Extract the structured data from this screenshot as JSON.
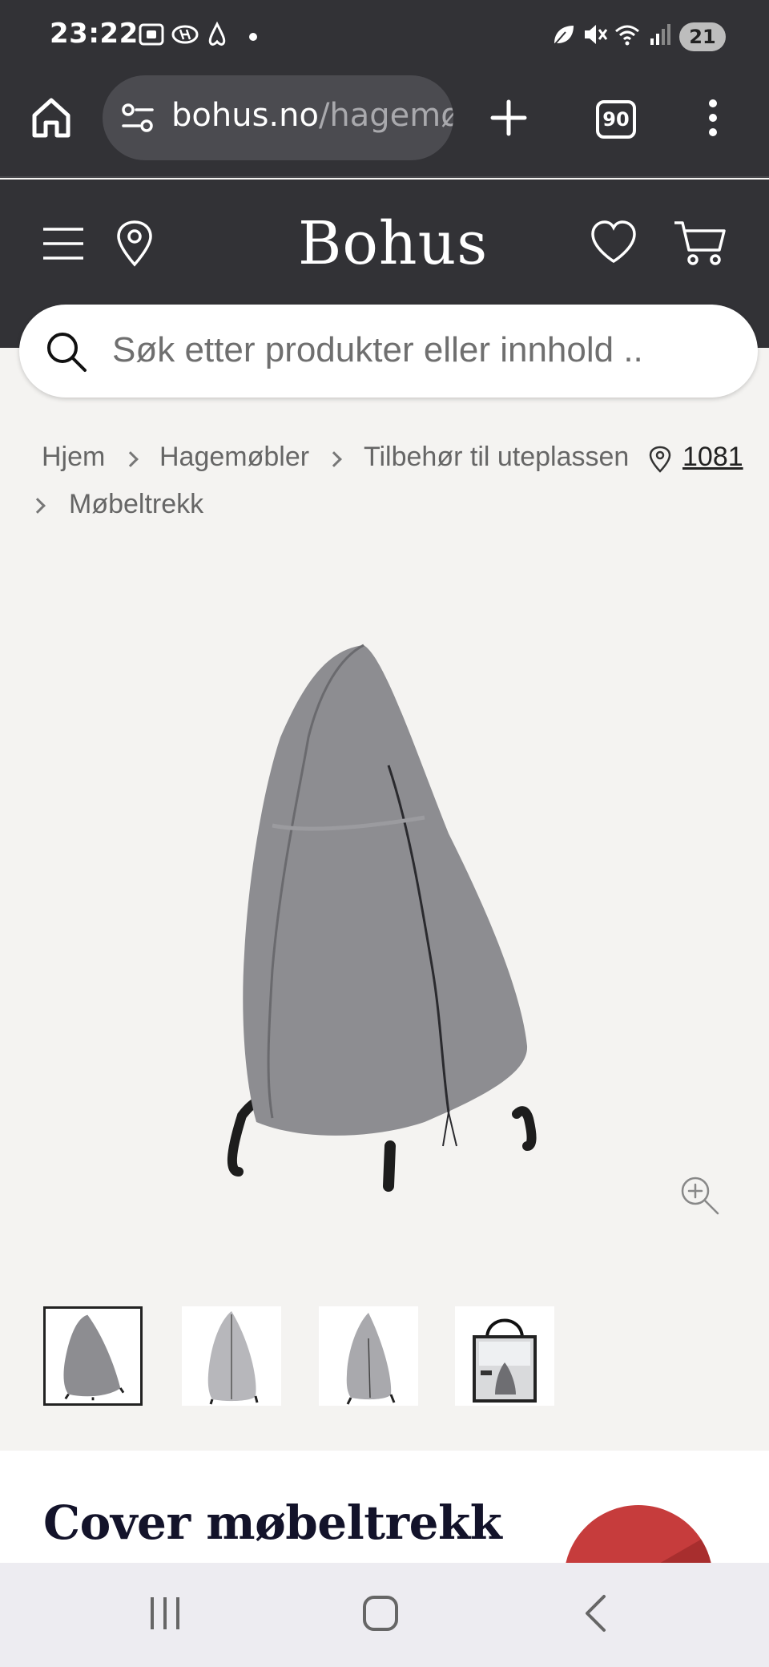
{
  "status_bar": {
    "time": "23:22",
    "battery": "21"
  },
  "browser": {
    "url_host": "bohus.no",
    "url_path": "/hagemø",
    "tab_count": "90"
  },
  "site": {
    "logo": "Bohus",
    "search_placeholder": "Søk etter produkter eller innhold .."
  },
  "breadcrumb": {
    "items": [
      "Hjem",
      "Hagemøbler",
      "Tilbehør til uteplassen",
      "Møbeltrekk"
    ],
    "store_code": "1081"
  },
  "product": {
    "title": "Cover møbeltrekk",
    "thumbnails": [
      "cover-front",
      "cover-side",
      "cover-back",
      "cover-package"
    ],
    "active_thumbnail": 0
  },
  "colors": {
    "header_bg": "#323236",
    "page_bg": "#f4f3f1",
    "accent_red": "#c63c3c"
  }
}
